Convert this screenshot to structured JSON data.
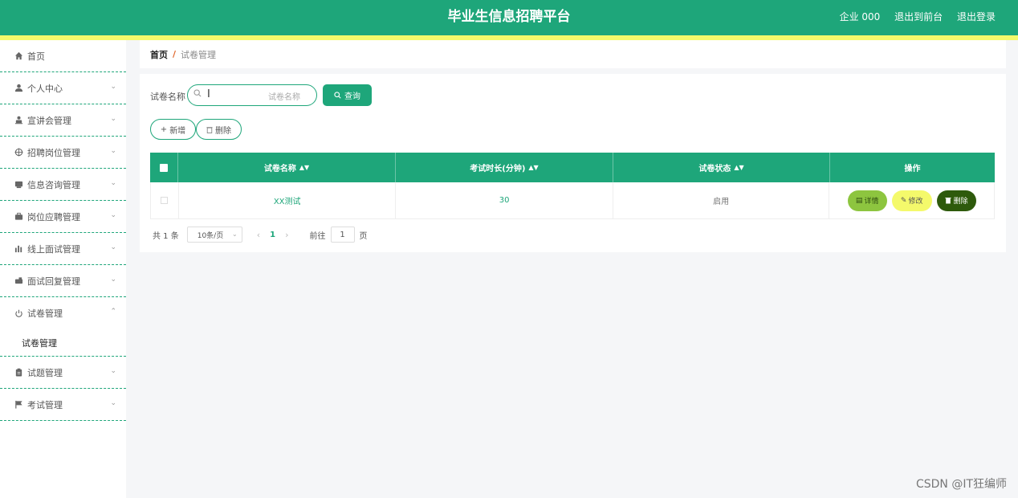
{
  "header": {
    "title": "毕业生信息招聘平台",
    "user": "企业 000",
    "back_to_front": "退出到前台",
    "logout": "退出登录"
  },
  "sidebar": {
    "items": [
      {
        "label": "首页",
        "icon": "home-icon",
        "chevron": false
      },
      {
        "label": "个人中心",
        "icon": "user-icon",
        "chevron": true
      },
      {
        "label": "宣讲会管理",
        "icon": "person-icon",
        "chevron": true
      },
      {
        "label": "招聘岗位管理",
        "icon": "target-icon",
        "chevron": true
      },
      {
        "label": "信息咨询管理",
        "icon": "card-icon",
        "chevron": true
      },
      {
        "label": "岗位应聘管理",
        "icon": "briefcase-icon",
        "chevron": true
      },
      {
        "label": "线上面试管理",
        "icon": "bar-chart-icon",
        "chevron": true
      },
      {
        "label": "面试回复管理",
        "icon": "reply-icon",
        "chevron": true
      },
      {
        "label": "试卷管理",
        "icon": "power-icon",
        "chevron": true,
        "expanded": true
      },
      {
        "label": "试题管理",
        "icon": "clipboard-icon",
        "chevron": true
      },
      {
        "label": "考试管理",
        "icon": "flag-icon",
        "chevron": true
      }
    ],
    "submenu_label": "试卷管理"
  },
  "breadcrumb": {
    "home": "首页",
    "separator": "/",
    "current": "试卷管理"
  },
  "search": {
    "label": "试卷名称",
    "placeholder": "试卷名称",
    "query_button": "查询"
  },
  "toolbar": {
    "add_label": "新增",
    "delete_label": "删除"
  },
  "table": {
    "columns": [
      "试卷名称",
      "考试时长(分钟)",
      "试卷状态",
      "操作"
    ],
    "rows": [
      {
        "name": "XX测试",
        "duration": "30",
        "status": "启用"
      }
    ],
    "actions": {
      "detail": "详情",
      "edit": "修改",
      "delete": "删除"
    }
  },
  "pagination": {
    "total": "共 1 条",
    "page_size": "10条/页",
    "current_page": "1",
    "goto_label": "前往",
    "goto_value": "1",
    "page_suffix": "页"
  },
  "watermark": "CSDN @IT狂编师",
  "colors": {
    "primary": "#1ea67a",
    "accent_yellow": "#f4f96b",
    "detail_btn": "#8dc53f",
    "delete_btn": "#2e5a0c"
  }
}
